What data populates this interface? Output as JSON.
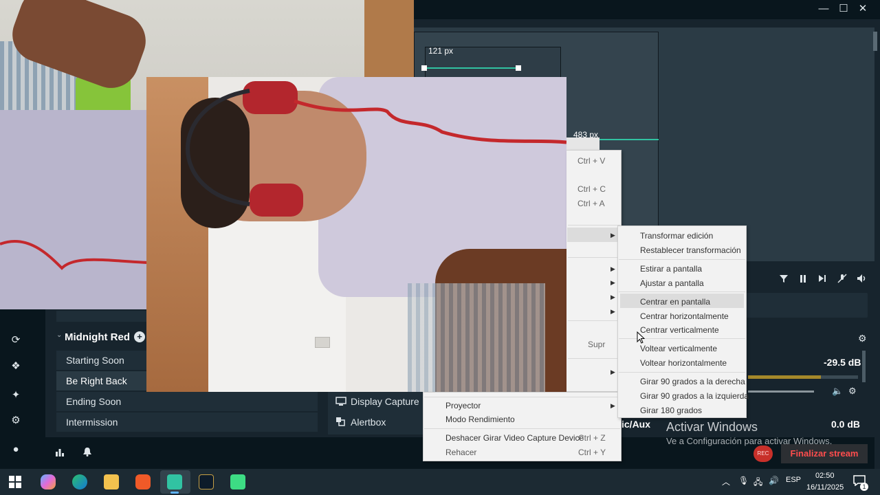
{
  "window": {
    "minimize": "—",
    "maximize": "☐",
    "close": "✕"
  },
  "editor": {
    "label_top": "121 px",
    "label_right": "483 px"
  },
  "scenes": {
    "collection": "Midnight Red",
    "items": [
      {
        "label": "Starting Soon"
      },
      {
        "label": "Be Right Back"
      },
      {
        "label": "Ending Soon"
      },
      {
        "label": "Intermission"
      }
    ]
  },
  "sources": {
    "items": [
      {
        "label": "Display Capture"
      },
      {
        "label": "Alertbox"
      }
    ]
  },
  "mixer": {
    "top_db": "-29.5 dB",
    "bottom_label": "ic/Aux",
    "bottom_db": "0.0 dB"
  },
  "stream": {
    "rec_label": "REC",
    "finalize_label": "Finalizar stream"
  },
  "main_menu": {
    "paste_shortcut": "Ctrl + V",
    "copy_shortcut": "Ctrl + C",
    "select_all_shortcut": "Ctrl + A",
    "delete_shortcut": "Supr",
    "projector": "Proyector",
    "performance_mode": "Modo Rendimiento",
    "undo": "Deshacer Girar Video Capture Device",
    "undo_shortcut": "Ctrl + Z",
    "redo": "Rehacer",
    "redo_shortcut": "Ctrl + Y"
  },
  "transform_menu": {
    "items": [
      "Transformar edición",
      "Restablecer transformación",
      "Estirar a pantalla",
      "Ajustar a pantalla",
      "Centrar en pantalla",
      "Centrar horizontalmente",
      "Centrar verticalmente",
      "Voltear verticalmente",
      "Voltear horizontalmente",
      "Girar 90 grados a la derecha",
      "Girar 90 grados a la izquierda",
      "Girar 180 grados"
    ]
  },
  "windows_watermark": {
    "title": "Activar Windows",
    "subtitle": "Ve a Configuración para activar Windows."
  },
  "taskbar": {
    "language": "ESP",
    "time": "02:50",
    "date": "16/11/2025",
    "notification_count": "1"
  }
}
